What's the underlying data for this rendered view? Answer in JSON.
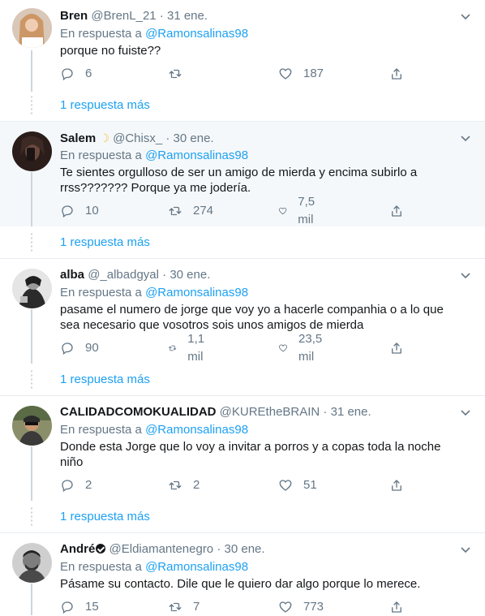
{
  "tweets": [
    {
      "name": "Bren",
      "handle": "@BrenL_21",
      "date": "31 ene.",
      "reply_prefix": "En respuesta a ",
      "reply_mention": "@Ramonsalinas98",
      "text": "porque no fuiste??",
      "replies": "6",
      "retweets": "",
      "likes": "187",
      "more_replies": "1 respuesta más"
    },
    {
      "name": "Salem",
      "handle": "@Chisx_",
      "date": "30 ene.",
      "reply_prefix": "En respuesta a ",
      "reply_mention": "@Ramonsalinas98",
      "text": "Te sientes orgulloso de ser un amigo de mierda y encima subirlo a rrss??????? Porque ya me jodería.",
      "replies": "10",
      "retweets": "274",
      "likes": "7,5 mil",
      "more_replies": "1 respuesta más"
    },
    {
      "name": "alba",
      "handle": "@_albadgyal",
      "date": "30 ene.",
      "reply_prefix": "En respuesta a ",
      "reply_mention": "@Ramonsalinas98",
      "text": "pasame el numero de jorge que voy yo a hacerle companhia o a lo que sea necesario que vosotros sois unos amigos de mierda",
      "replies": "90",
      "retweets": "1,1 mil",
      "likes": "23,5 mil",
      "more_replies": "1 respuesta más"
    },
    {
      "name": "CALIDADCOMOKUALIDAD",
      "handle": "@KUREtheBRAIN",
      "date": "31 ene.",
      "reply_prefix": "En respuesta a ",
      "reply_mention": "@Ramonsalinas98",
      "text": "Donde esta Jorge que lo voy a invitar a porros y a copas toda la noche niño",
      "replies": "2",
      "retweets": "2",
      "likes": "51",
      "more_replies": "1 respuesta más"
    },
    {
      "name": "André",
      "handle": "@Eldiamantenegro",
      "date": "30 ene.",
      "reply_prefix": "En respuesta a ",
      "reply_mention": "@Ramonsalinas98",
      "text": "Pásame su contacto. Dile que le quiero dar algo porque lo merece.",
      "replies": "15",
      "retweets": "7",
      "likes": "773",
      "more_replies": ""
    }
  ],
  "separator": " · ",
  "icons": {
    "reply": "reply-icon",
    "retweet": "retweet-icon",
    "like": "heart-icon",
    "share": "share-icon",
    "caret": "chevron-down-icon"
  },
  "colors": {
    "accent": "#1da1f2",
    "secondary_text": "#657786",
    "highlight_bg": "#f5f8fa",
    "border": "#e6ecf0"
  }
}
